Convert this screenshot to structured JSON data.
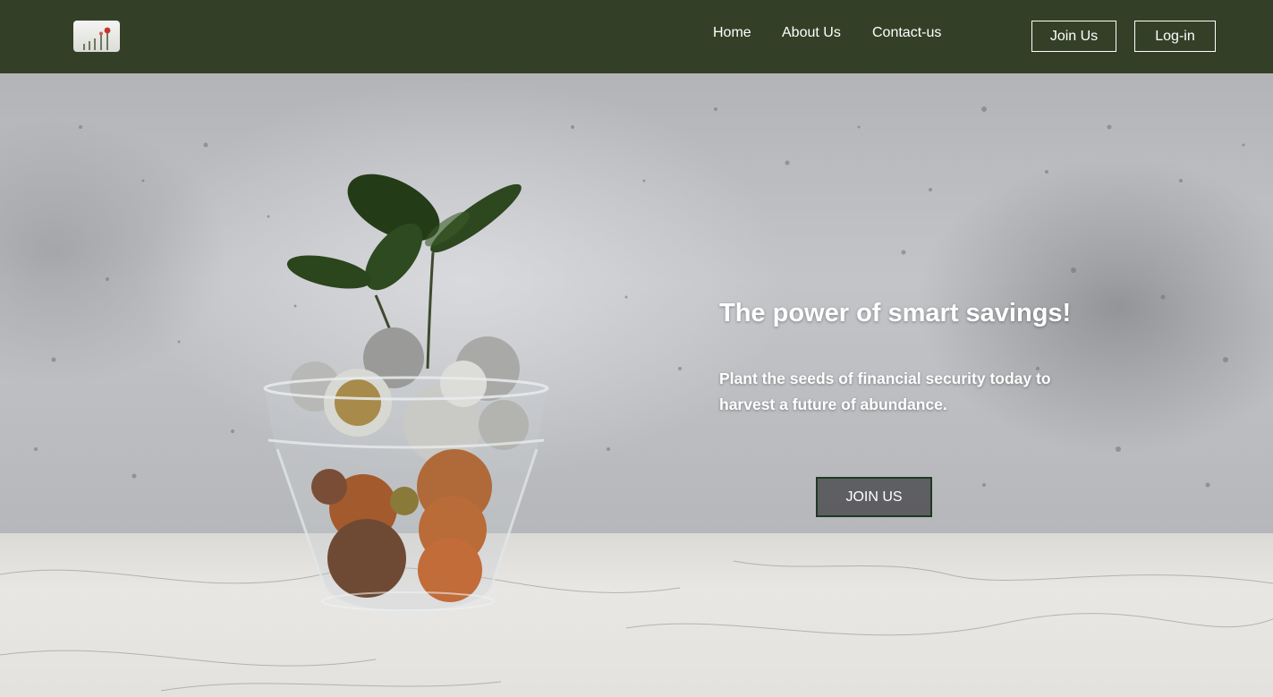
{
  "header": {
    "logo_icon": "plant-growth-logo-icon",
    "nav": {
      "home": "Home",
      "about": "About Us",
      "contact": "Contact-us"
    },
    "join_label": "Join Us",
    "login_label": "Log-in"
  },
  "hero": {
    "image": "plant-in-coin-jar-photo",
    "title": "The power of smart savings!",
    "subtitle": "Plant the seeds of financial security today to harvest a future of abundance.",
    "cta_label": "JOIN US"
  },
  "colors": {
    "header_bg": "#334027",
    "text": "#ffffff",
    "cta_border": "#1f3a22"
  }
}
